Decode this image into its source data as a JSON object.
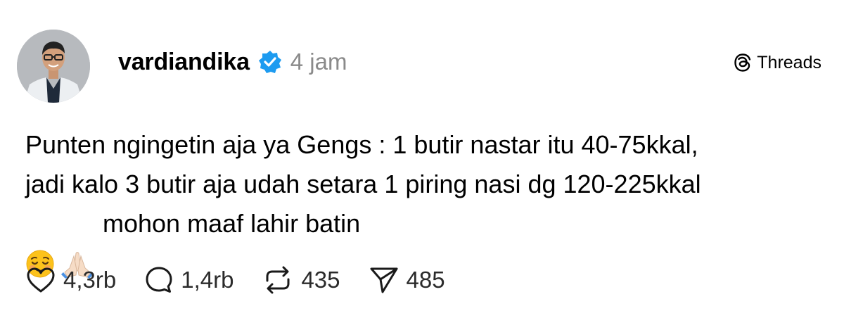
{
  "post": {
    "username": "vardiandika",
    "time": "4 jam",
    "brand": "Threads",
    "text_lines": [
      "Punten ngingetin aja ya Gengs : 1 butir nastar itu 40-75kkal,",
      "jadi kalo 3 butir aja udah setara 1 piring nasi dg 120-225kkal"
    ],
    "text_tail": "mohon maaf lahir batin",
    "emoji": [
      "smiling-face-emoji",
      "folded-hands-emoji"
    ]
  },
  "actions": {
    "likes": "4,3rb",
    "replies": "1,4rb",
    "reposts": "435",
    "shares": "485"
  },
  "icons": {
    "verified": "verified-badge-icon",
    "brand": "threads-logo-icon",
    "like": "heart-icon",
    "reply": "speech-bubble-icon",
    "repost": "repost-arrows-icon",
    "share": "paper-plane-icon"
  },
  "colors": {
    "verified": "#1d9bf0",
    "muted_text": "#8a8a8a",
    "text": "#000000"
  }
}
